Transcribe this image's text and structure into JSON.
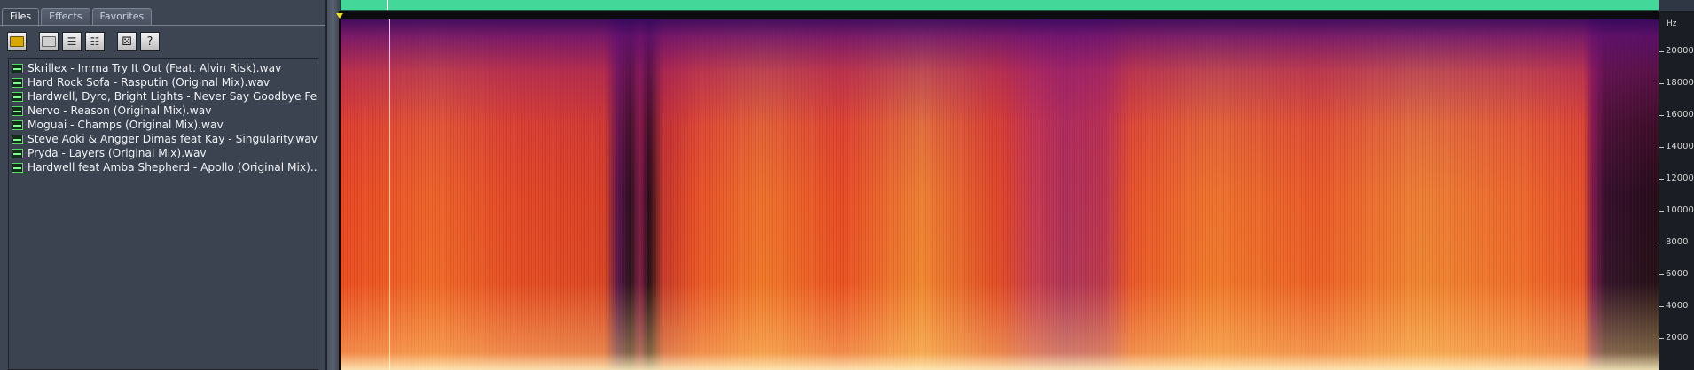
{
  "tabs": [
    {
      "label": "Files"
    },
    {
      "label": "Effects"
    },
    {
      "label": "Favorites"
    }
  ],
  "toolbar": {
    "open_icon": "folder-open-icon",
    "folder_icon": "folder-icon",
    "list_icon": "list-icon",
    "list2_icon": "list-icon",
    "dice_icon": "dice-icon",
    "help_label": "?"
  },
  "files": [
    "Skrillex - Imma Try It Out (Feat. Alvin Risk).wav",
    "Hard Rock Sofa - Rasputin (Original Mix).wav",
    "Hardwell, Dyro, Bright Lights - Never Say Goodbye Fe...",
    "Nervo - Reason (Original Mix).wav",
    "Moguai - Champs (Original Mix).wav",
    "Steve Aoki & Angger Dimas feat Kay - Singularity.wav",
    "Pryda - Layers (Original Mix).wav",
    "Hardwell feat Amba Shepherd - Apollo (Original Mix)...."
  ],
  "axis": {
    "unit": "Hz",
    "ticks": [
      "20000",
      "18000",
      "16000",
      "14000",
      "12000",
      "10000",
      "8000",
      "6000",
      "4000",
      "2000"
    ]
  },
  "colors": {
    "overview_bar": "#43d89a",
    "panel_bg": "#3d4553",
    "spectrogram_hot": "#ffd27a",
    "spectrogram_mid": "#e84a22",
    "spectrogram_cold": "#3a0a60"
  }
}
